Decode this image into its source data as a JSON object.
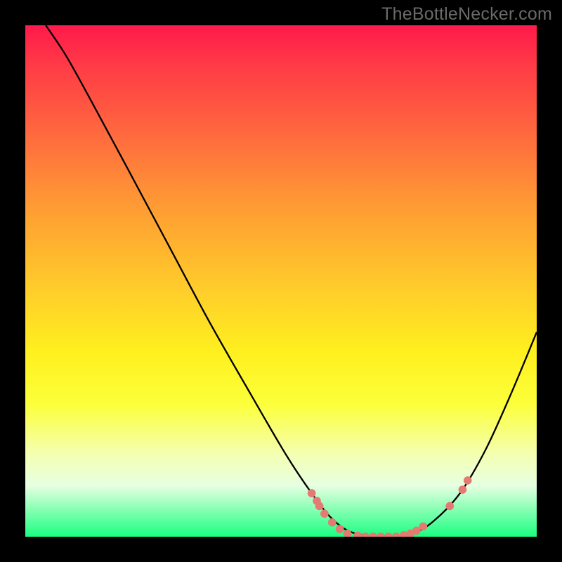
{
  "watermark": "TheBottleNecker.com",
  "chart_data": {
    "type": "line",
    "title": "",
    "xlabel": "",
    "ylabel": "",
    "xlim": [
      0,
      1000
    ],
    "ylim": [
      0,
      1000
    ],
    "curve": [
      {
        "x": 40,
        "y": 1000
      },
      {
        "x": 80,
        "y": 940
      },
      {
        "x": 130,
        "y": 850
      },
      {
        "x": 200,
        "y": 720
      },
      {
        "x": 280,
        "y": 570
      },
      {
        "x": 360,
        "y": 420
      },
      {
        "x": 440,
        "y": 280
      },
      {
        "x": 510,
        "y": 160
      },
      {
        "x": 560,
        "y": 85
      },
      {
        "x": 600,
        "y": 35
      },
      {
        "x": 640,
        "y": 8
      },
      {
        "x": 700,
        "y": 0
      },
      {
        "x": 760,
        "y": 8
      },
      {
        "x": 800,
        "y": 32
      },
      {
        "x": 850,
        "y": 85
      },
      {
        "x": 900,
        "y": 170
      },
      {
        "x": 950,
        "y": 280
      },
      {
        "x": 1000,
        "y": 400
      }
    ],
    "markers": [
      {
        "x": 560,
        "y": 85
      },
      {
        "x": 570,
        "y": 70
      },
      {
        "x": 575,
        "y": 60
      },
      {
        "x": 585,
        "y": 45
      },
      {
        "x": 600,
        "y": 28
      },
      {
        "x": 615,
        "y": 15
      },
      {
        "x": 630,
        "y": 6
      },
      {
        "x": 650,
        "y": 2
      },
      {
        "x": 665,
        "y": 0
      },
      {
        "x": 680,
        "y": 0
      },
      {
        "x": 695,
        "y": 0
      },
      {
        "x": 710,
        "y": 0
      },
      {
        "x": 725,
        "y": 0
      },
      {
        "x": 740,
        "y": 3
      },
      {
        "x": 753,
        "y": 6
      },
      {
        "x": 765,
        "y": 12
      },
      {
        "x": 778,
        "y": 20
      },
      {
        "x": 830,
        "y": 60
      },
      {
        "x": 855,
        "y": 92
      },
      {
        "x": 865,
        "y": 110
      }
    ],
    "marker_color": "#e47a72",
    "curve_color": "#000000"
  }
}
